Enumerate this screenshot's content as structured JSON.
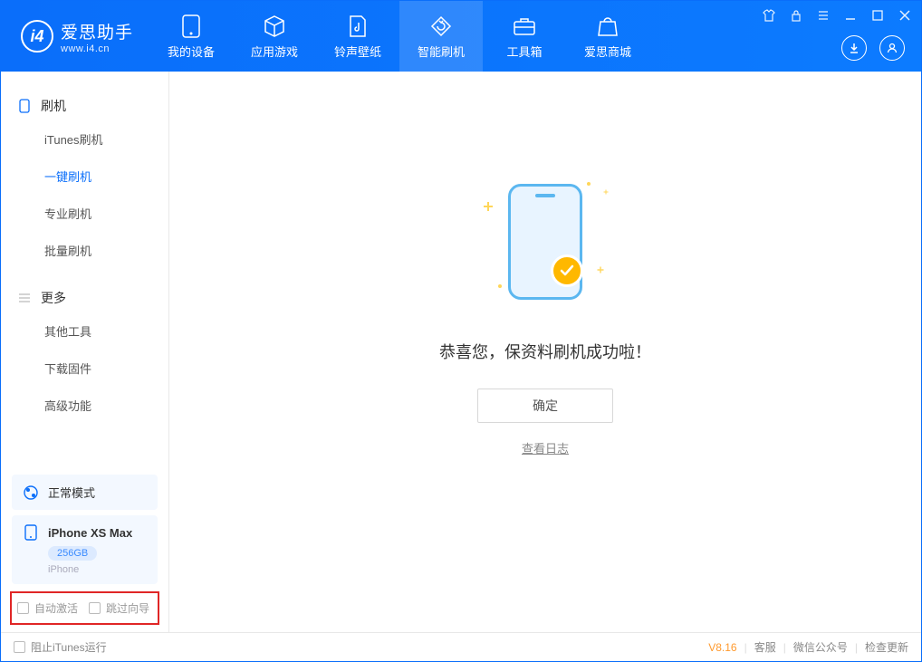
{
  "app": {
    "name": "爱思助手",
    "url": "www.i4.cn"
  },
  "nav": [
    {
      "label": "我的设备",
      "icon": "device"
    },
    {
      "label": "应用游戏",
      "icon": "cube"
    },
    {
      "label": "铃声壁纸",
      "icon": "music"
    },
    {
      "label": "智能刷机",
      "icon": "refresh",
      "active": true
    },
    {
      "label": "工具箱",
      "icon": "toolbox"
    },
    {
      "label": "爱思商城",
      "icon": "bag"
    }
  ],
  "sidebar": {
    "groups": [
      {
        "title": "刷机",
        "icon": "phone-small",
        "items": [
          "iTunes刷机",
          "一键刷机",
          "专业刷机",
          "批量刷机"
        ],
        "activeIndex": 1
      },
      {
        "title": "更多",
        "icon": "menu",
        "items": [
          "其他工具",
          "下载固件",
          "高级功能"
        ],
        "activeIndex": -1
      }
    ],
    "mode": {
      "label": "正常模式"
    },
    "device": {
      "name": "iPhone XS Max",
      "storage": "256GB",
      "type": "iPhone"
    },
    "checks": {
      "auto_activate": "自动激活",
      "skip_guide": "跳过向导"
    }
  },
  "main": {
    "message": "恭喜您，保资料刷机成功啦！",
    "ok": "确定",
    "log": "查看日志"
  },
  "footer": {
    "block_itunes": "阻止iTunes运行",
    "version": "V8.16",
    "links": [
      "客服",
      "微信公众号",
      "检查更新"
    ]
  }
}
